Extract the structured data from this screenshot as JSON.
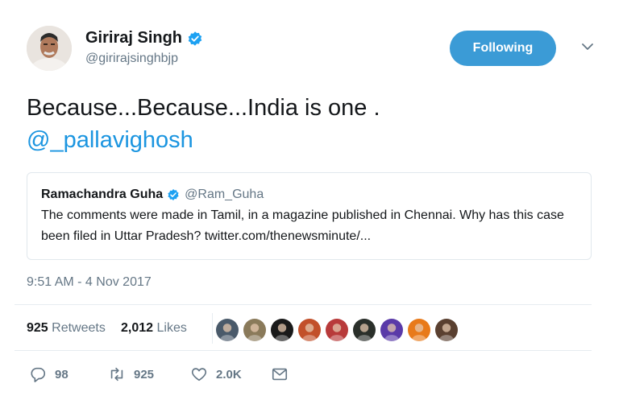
{
  "author": {
    "display_name": "Giriraj Singh",
    "handle": "@girirajsinghbjp",
    "verified": true
  },
  "follow_button": {
    "label": "Following"
  },
  "tweet": {
    "text": "Because...Because...India is one .",
    "mention": "@_pallavighosh"
  },
  "quoted_tweet": {
    "display_name": "Ramachandra Guha",
    "handle": "@Ram_Guha",
    "verified": true,
    "text": "The comments were made in Tamil, in a magazine published in Chennai. Why has this case been filed in Uttar Pradesh? twitter.com/thenewsminute/..."
  },
  "timestamp": "9:51 AM - 4 Nov 2017",
  "stats": {
    "retweets_count": "925",
    "retweets_label": "Retweets",
    "likes_count": "2,012",
    "likes_label": "Likes"
  },
  "liker_avatars": [
    {
      "icon": "user-avatar",
      "color": "#4a5a6a"
    },
    {
      "icon": "user-avatar",
      "color": "#8a7a5a"
    },
    {
      "icon": "user-avatar",
      "color": "#1a1a1a"
    },
    {
      "icon": "user-avatar",
      "color": "#c2502a"
    },
    {
      "icon": "user-avatar",
      "color": "#b83a3a"
    },
    {
      "icon": "user-avatar",
      "color": "#2a2f2a"
    },
    {
      "icon": "user-avatar",
      "color": "#5a3aa8"
    },
    {
      "icon": "user-avatar",
      "color": "#e87a1a"
    },
    {
      "icon": "user-avatar",
      "color": "#5a4030"
    }
  ],
  "actions": {
    "reply_count": "98",
    "retweet_count": "925",
    "like_count": "2.0K"
  },
  "colors": {
    "accent": "#1b95e0",
    "follow_bg": "#3b9bd6",
    "muted": "#657786"
  }
}
